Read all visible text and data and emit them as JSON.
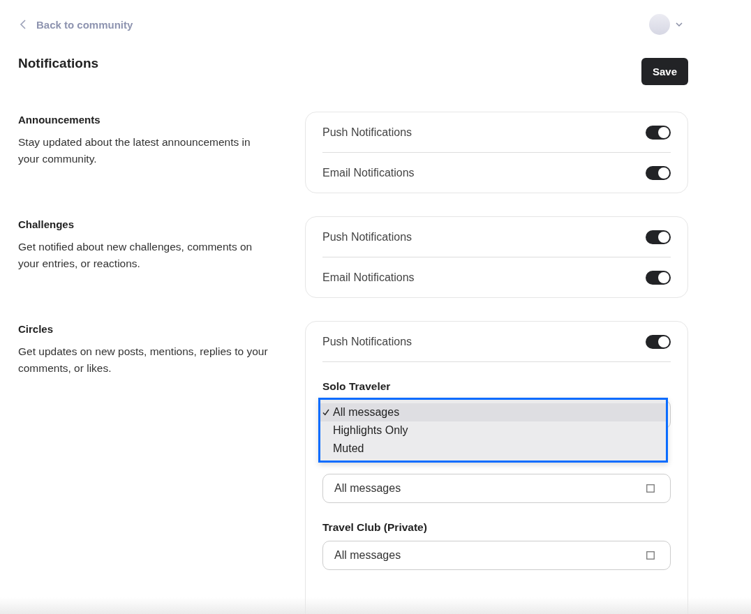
{
  "back_link": "Back to community",
  "title": "Notifications",
  "save_button": "Save",
  "sections": [
    {
      "title": "Announcements",
      "description": "Stay updated about the latest announcements in your community.",
      "toggles": [
        {
          "label": "Push Notifications",
          "on": true
        },
        {
          "label": "Email Notifications",
          "on": true
        }
      ]
    },
    {
      "title": "Challenges",
      "description": "Get notified about new challenges, comments on your entries, or reactions.",
      "toggles": [
        {
          "label": "Push Notifications",
          "on": true
        },
        {
          "label": "Email Notifications",
          "on": true
        }
      ]
    },
    {
      "title": "Circles",
      "description": "Get updates on new posts, mentions, replies to your comments, or likes.",
      "toggles": [
        {
          "label": "Push Notifications",
          "on": true
        }
      ],
      "groups": [
        {
          "label": "Solo Traveler",
          "expanded": true,
          "options": [
            {
              "label": "All messages",
              "selected": true
            },
            {
              "label": "Highlights Only",
              "selected": false
            },
            {
              "label": "Muted",
              "selected": false
            }
          ]
        },
        {
          "value": "All messages",
          "expanded": false
        },
        {
          "label": "Travel Club (Private)",
          "value": "All messages",
          "expanded": false
        }
      ]
    }
  ]
}
